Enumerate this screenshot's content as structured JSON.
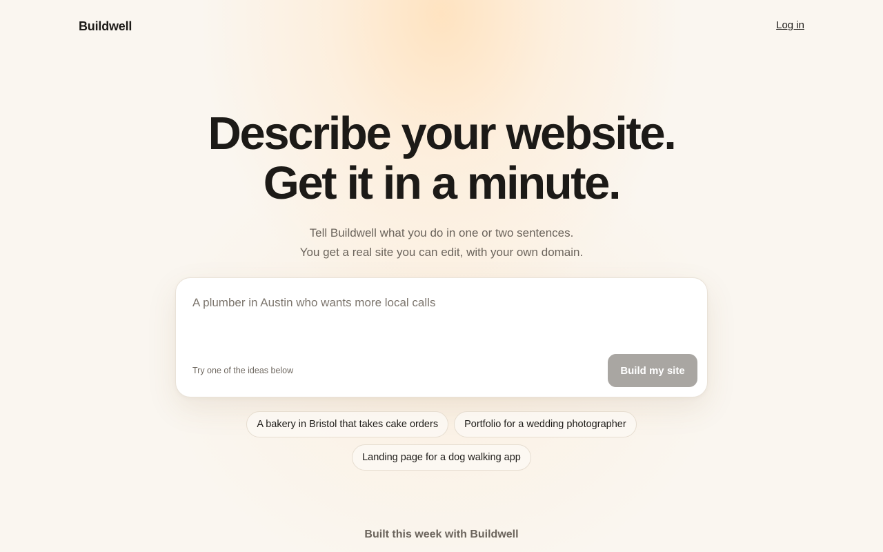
{
  "nav": {
    "logo": "Buildwell",
    "login": "Log in"
  },
  "hero": {
    "headline_line1": "Describe your website.",
    "headline_line2": "Get it in a minute.",
    "sub_line1": "Tell Buildwell what you do in one or two sentences.",
    "sub_line2": "You get a real site you can edit, with your own domain."
  },
  "prompt": {
    "placeholder": "A plumber in Austin who wants more local calls",
    "value": "",
    "hint": "Try one of the ideas below",
    "button": "Build my site"
  },
  "ideas": [
    "A bakery in Bristol that takes cake orders",
    "Portfolio for a wedding photographer",
    "Landing page for a dog walking app"
  ],
  "footer": {
    "built_label": "Built this week with Buildwell"
  },
  "colors": {
    "text": "#1c1a17",
    "muted": "#6b645c",
    "button_disabled": "#a9a6a2",
    "background": "#faf6f0"
  }
}
